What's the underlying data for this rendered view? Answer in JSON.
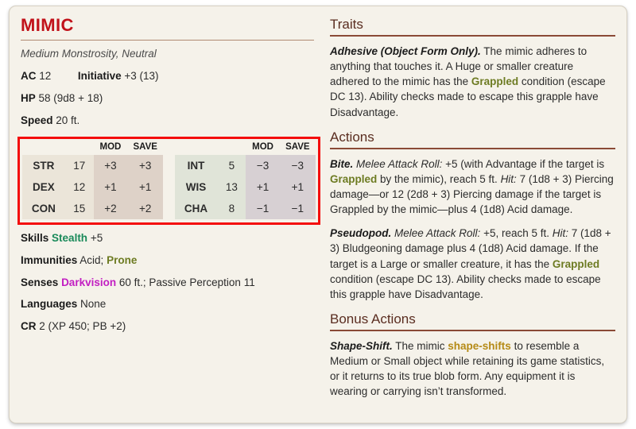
{
  "statblock": {
    "name": "MIMIC",
    "subtitle": "Medium Monstrosity, Neutral",
    "ac_label": "AC",
    "ac_value": "12",
    "initiative_label": "Initiative",
    "initiative_value": "+3 (13)",
    "hp_label": "HP",
    "hp_value": "58 (9d8 + 18)",
    "speed_label": "Speed",
    "speed_value": "20 ft.",
    "abilities": {
      "headers": {
        "mod": "MOD",
        "save": "SAVE"
      },
      "left": [
        {
          "name": "STR",
          "score": "17",
          "mod": "+3",
          "save": "+3"
        },
        {
          "name": "DEX",
          "score": "12",
          "mod": "+1",
          "save": "+1"
        },
        {
          "name": "CON",
          "score": "15",
          "mod": "+2",
          "save": "+2"
        }
      ],
      "right": [
        {
          "name": "INT",
          "score": "5",
          "mod": "−3",
          "save": "−3"
        },
        {
          "name": "WIS",
          "score": "13",
          "mod": "+1",
          "save": "+1"
        },
        {
          "name": "CHA",
          "score": "8",
          "mod": "−1",
          "save": "−1"
        }
      ]
    },
    "details": {
      "skills_label": "Skills",
      "skills_link": "Stealth",
      "skills_rest": "+5",
      "immunities_label": "Immunities",
      "immunities_plain": "Acid;",
      "immunities_link": "Prone",
      "senses_label": "Senses",
      "senses_link": "Darkvision",
      "senses_rest": "60 ft.; Passive Perception 11",
      "languages_label": "Languages",
      "languages_value": "None",
      "cr_label": "CR",
      "cr_value": "2 (XP 450; PB +2)"
    }
  },
  "sections": {
    "traits": {
      "heading": "Traits",
      "adhesive": {
        "name": "Adhesive (Object Form Only).",
        "t1": " The mimic adheres to anything that touches it. A Huge or smaller creature adhered to the mimic has the ",
        "link": "Grappled",
        "t2": " condition (escape DC 13). Ability checks made to escape this grapple have Disadvantage."
      }
    },
    "actions": {
      "heading": "Actions",
      "bite": {
        "name": "Bite.",
        "roll_label": "Melee Attack Roll:",
        "t1": " +5 (with Advantage if the target is ",
        "link": "Grappled",
        "t2": " by the mimic), reach 5 ft. ",
        "hit_label": "Hit:",
        "t3": " 7 (1d8 + 3) Piercing damage—or 12 (2d8 + 3) Piercing damage if the target is Grappled by the mimic—plus 4 (1d8) Acid damage."
      },
      "pseudopod": {
        "name": "Pseudopod.",
        "roll_label": "Melee Attack Roll:",
        "t1": " +5, reach 5 ft. ",
        "hit_label": "Hit:",
        "t2": " 7 (1d8 + 3) Bludgeoning damage plus 4 (1d8) Acid damage. If the target is a Large or smaller creature, it has the ",
        "link": "Grappled",
        "t3": " condition (escape DC 13). Ability checks made to escape this grapple have Disadvantage."
      }
    },
    "bonus_actions": {
      "heading": "Bonus Actions",
      "shapeshift": {
        "name": "Shape-Shift.",
        "t1": " The mimic ",
        "link": "shape-shifts",
        "t2": " to resemble a Medium or Small object while retaining its game statistics, or it returns to its true blob form. Any equipment it is wearing or carrying isn’t transformed."
      }
    }
  },
  "annotation": {
    "highlight_color": "#f40d0d",
    "highlight_target": "ability-score-table"
  }
}
